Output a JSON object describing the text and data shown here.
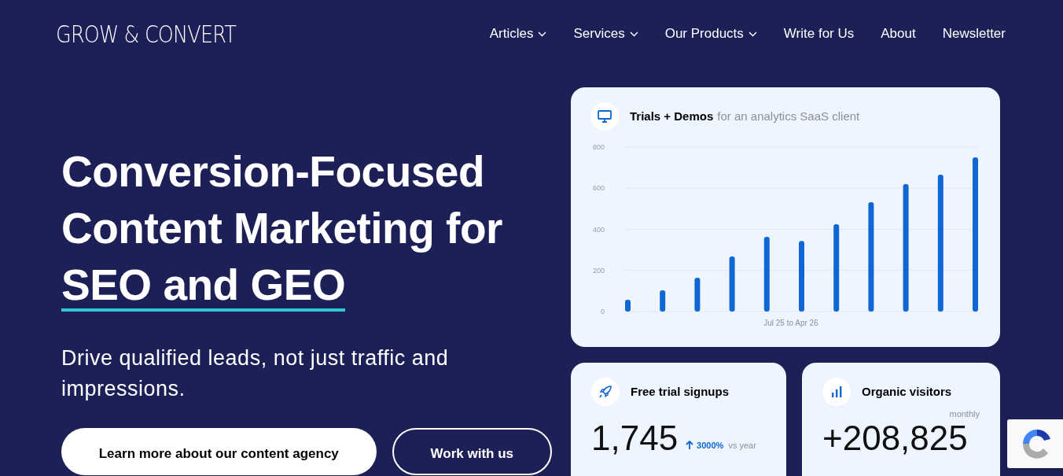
{
  "header": {
    "logo": "GROW & CONVERT",
    "nav": [
      {
        "label": "Articles",
        "has_dropdown": true
      },
      {
        "label": "Services",
        "has_dropdown": true
      },
      {
        "label": "Our Products",
        "has_dropdown": true
      },
      {
        "label": "Write for Us",
        "has_dropdown": false
      },
      {
        "label": "About",
        "has_dropdown": false
      },
      {
        "label": "Newsletter",
        "has_dropdown": false
      }
    ]
  },
  "hero": {
    "headline_lines": [
      "Conversion-Focused",
      "Content Marketing for"
    ],
    "headline_highlight": "SEO and GEO",
    "subheadline": "Drive qualified leads, not just traffic and impressions.",
    "buttons": [
      {
        "label": "Learn more about our content agency",
        "kind": "filled"
      },
      {
        "label": "Work with us",
        "kind": "outline"
      }
    ]
  },
  "chart_card": {
    "title": "Trials + Demos",
    "subtitle": "for an analytics SaaS client",
    "chart_data": {
      "type": "bar",
      "grid": true,
      "xlabel": "Jul 25 to Apr 26",
      "ylim": [
        0,
        800
      ],
      "yticks": [
        0,
        200,
        400,
        600,
        800
      ],
      "series": [
        {
          "color": "#0f67d4",
          "values": [
            57,
            103,
            165,
            268,
            364,
            344,
            425,
            532,
            620,
            666,
            750
          ]
        }
      ]
    }
  },
  "stat_cards": [
    {
      "title": "Free trial signups",
      "kind": "rocket",
      "value": "1,745",
      "change": "3000%",
      "change_note": "vs year"
    },
    {
      "title": "Organic visitors",
      "kind": "bars",
      "period": "monthly",
      "value": "+208,825"
    }
  ]
}
